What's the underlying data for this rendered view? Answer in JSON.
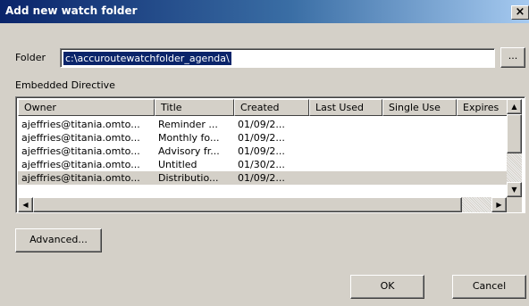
{
  "window": {
    "title": "Add new watch folder",
    "close_glyph": "×"
  },
  "folder": {
    "label": "Folder",
    "value": "c:\\accuroutewatchfolder_agenda\\",
    "browse_label": "..."
  },
  "directive": {
    "label": "Embedded Directive",
    "columns": [
      "Owner",
      "Title",
      "Created",
      "Last Used",
      "Single Use",
      "Expires"
    ],
    "rows": [
      [
        "ajeffries@titania.omto...",
        "Reminder ...",
        "01/09/2...",
        "",
        ""
      ],
      [
        "ajeffries@titania.omto...",
        "Monthly fo...",
        "01/09/2...",
        "",
        ""
      ],
      [
        "ajeffries@titania.omto...",
        "Advisory fr...",
        "01/09/2...",
        "",
        ""
      ],
      [
        "ajeffries@titania.omto...",
        "Untitled",
        "01/30/2...",
        "",
        ""
      ],
      [
        "ajeffries@titania.omto...",
        "Distributio...",
        "01/09/2...",
        "",
        ""
      ]
    ],
    "selected_row": 4,
    "scroll_up_glyph": "▲",
    "scroll_down_glyph": "▼",
    "scroll_left_glyph": "◀",
    "scroll_right_glyph": "▶"
  },
  "buttons": {
    "advanced": "Advanced...",
    "ok": "OK",
    "cancel": "Cancel"
  },
  "colors": {
    "title_bar_start": "#0a246a",
    "title_bar_end": "#a6caf0",
    "selection": "#0a246a",
    "face": "#d4d0c8"
  }
}
